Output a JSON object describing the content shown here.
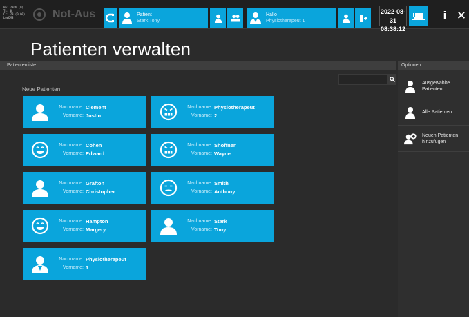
{
  "system_info": [
    "Pn: 23Gb (0)",
    "Ts: 0",
    "Cr: 79 (0.00)",
    "LowDMS"
  ],
  "top": {
    "not_aus_label": "Not-Aus",
    "patient_title": "Patient",
    "patient_name": "Stark Tony",
    "hallo_title": "Hallo",
    "hallo_name": "Physiotherapeut 1",
    "date": "2022-08-31",
    "time": "08:38:12",
    "info_label": "i",
    "close_label": "✕"
  },
  "page_title": "Patienten verwalten",
  "patient_list_header": "Patientenliste",
  "options_header": "Optionen",
  "search": {
    "placeholder": "",
    "button_icon": "search-icon"
  },
  "group_label": "Neue Patienten",
  "field_labels": {
    "lastname": "Nachname:",
    "firstname": "Vorname:"
  },
  "patients": [
    {
      "lastname": "Clement",
      "firstname": "Justin",
      "icon": "person-icon"
    },
    {
      "lastname": "Physiotherapeut",
      "firstname": "2",
      "icon": "angry-face-icon"
    },
    {
      "lastname": "Cohen",
      "firstname": "Edward",
      "icon": "smile-face-icon"
    },
    {
      "lastname": "Shoffner",
      "firstname": "Wayne",
      "icon": "angry-face-icon"
    },
    {
      "lastname": "Grafton",
      "firstname": "Christopher",
      "icon": "person-icon"
    },
    {
      "lastname": "Smith",
      "firstname": "Anthony",
      "icon": "neutral-face-icon"
    },
    {
      "lastname": "Hampton",
      "firstname": "Margery",
      "icon": "smile-face-icon"
    },
    {
      "lastname": "Stark",
      "firstname": "Tony",
      "icon": "person-icon"
    },
    {
      "lastname": "Physiotherapeut",
      "firstname": "1",
      "icon": "doctor-icon"
    }
  ],
  "options": [
    {
      "label": "Ausgewählte Patienten",
      "icon": "person-icon"
    },
    {
      "label": "Alle Patienten",
      "icon": "person-icon"
    },
    {
      "label": "Neuen Patienten hinzufügen",
      "icon": "add-patient-icon"
    }
  ],
  "colors": {
    "accent": "#0aa5dc",
    "background": "#2b2b2b",
    "topbar": "#1f1f1f"
  }
}
